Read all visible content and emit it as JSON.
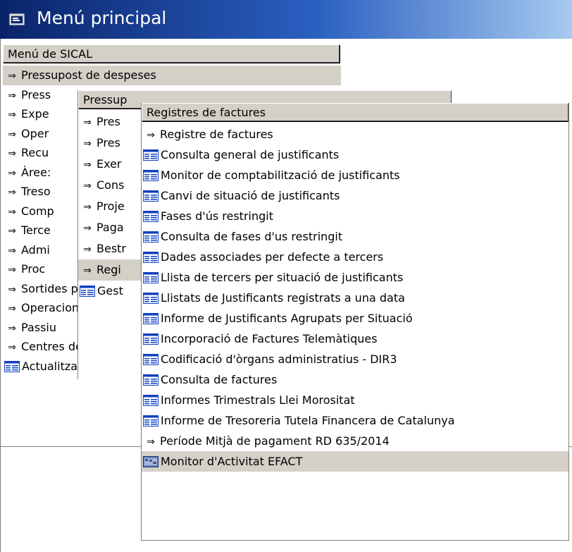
{
  "window": {
    "title": "Menú principal",
    "icon": "window-app-icon"
  },
  "menu1": {
    "header": "Menú de SICAL",
    "items": [
      {
        "label": "Pressupost de despeses",
        "type": "arrow",
        "selected": true
      },
      {
        "label": "Press",
        "type": "arrow"
      },
      {
        "label": "Expe",
        "type": "arrow"
      },
      {
        "label": "Oper",
        "type": "arrow"
      },
      {
        "label": "Recu",
        "type": "arrow"
      },
      {
        "label": "Àree:",
        "type": "arrow"
      },
      {
        "label": "Treso",
        "type": "arrow"
      },
      {
        "label": "Comp",
        "type": "arrow"
      },
      {
        "label": "Terce",
        "type": "arrow"
      },
      {
        "label": "Admi",
        "type": "arrow"
      },
      {
        "label": "Proc",
        "type": "arrow"
      },
      {
        "label": "Sortides per im",
        "type": "arrow"
      },
      {
        "label": "Operacions de",
        "type": "arrow"
      },
      {
        "label": "Passiu",
        "type": "arrow"
      },
      {
        "label": "Centres de Cos",
        "type": "arrow"
      },
      {
        "label": "Actualització h",
        "type": "form"
      }
    ]
  },
  "menu2": {
    "header": "Pressup",
    "items": [
      {
        "label": "Pres",
        "type": "arrow"
      },
      {
        "label": "Pres",
        "type": "arrow"
      },
      {
        "label": "Exer",
        "type": "arrow"
      },
      {
        "label": "Cons",
        "type": "arrow"
      },
      {
        "label": "Proje",
        "type": "arrow"
      },
      {
        "label": "Paga",
        "type": "arrow"
      },
      {
        "label": "Bestr",
        "type": "arrow"
      },
      {
        "label": "Regi",
        "type": "arrow",
        "selected": true
      },
      {
        "label": "Gest",
        "type": "form"
      }
    ]
  },
  "menu3": {
    "header": "Registres de factures",
    "items": [
      {
        "label": "Registre de factures",
        "type": "arrow"
      },
      {
        "label": "Consulta general de justificants",
        "type": "form"
      },
      {
        "label": "Monitor de comptabilització de justificants",
        "type": "form"
      },
      {
        "label": "Canvi de situació de justificants",
        "type": "form"
      },
      {
        "label": "Fases d'ús restringit",
        "type": "form"
      },
      {
        "label": "Consulta de fases d'us restringit",
        "type": "form"
      },
      {
        "label": "Dades associades per defecte a tercers",
        "type": "form"
      },
      {
        "label": "Llista de tercers per situació de justificants",
        "type": "form"
      },
      {
        "label": "Llistats de Justificants registrats a una data",
        "type": "form"
      },
      {
        "label": "Informe de Justificants Agrupats per Situació",
        "type": "form"
      },
      {
        "label": "Incorporació de Factures Telemàtiques",
        "type": "form"
      },
      {
        "label": "Codificació d'òrgans administratius - DIR3",
        "type": "form"
      },
      {
        "label": "Consulta de factures",
        "type": "form"
      },
      {
        "label": "Informes Trimestrals Llei Morositat",
        "type": "form"
      },
      {
        "label": "Informe de Tresoreria Tutela Financera de Catalunya",
        "type": "form"
      },
      {
        "label": "Període Mitjà de pagament RD 635/2014",
        "type": "arrow"
      },
      {
        "label": "Monitor d'Activitat EFACT",
        "type": "web",
        "selected": true
      }
    ]
  },
  "colors": {
    "title_start": "#0a246a",
    "title_end": "#a6caf0",
    "selection": "#d4d0c8",
    "form_icon": "#1040c0"
  }
}
